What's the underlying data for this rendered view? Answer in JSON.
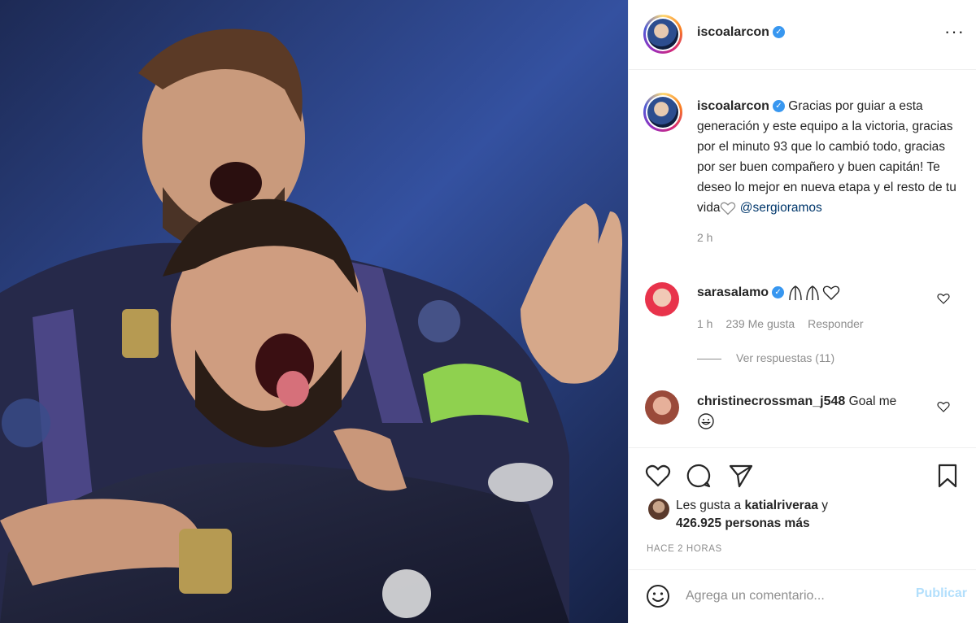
{
  "post": {
    "author": "iscoalarcon",
    "more_icon": "more-horizontal-icon",
    "image_description_icon": "photo"
  },
  "caption": {
    "username": "iscoalarcon",
    "text": "Gracias por guiar a esta generación y este equipo a la victoria, gracias por el minuto 93 que lo cambió todo, gracias por ser buen compañero y buen capitán! Te deseo lo mejor en nueva etapa y el resto de tu vida",
    "mention": "@sergioramos",
    "time": "2 h"
  },
  "comments": [
    {
      "username": "sarasalamo",
      "text": "",
      "time": "1 h",
      "likes": "239 Me gusta",
      "reply_label": "Responder",
      "view_replies": "Ver respuestas (11)"
    },
    {
      "username": "christinecrossman_j548",
      "text": "Goal me"
    }
  ],
  "likes": {
    "prefix": "Les gusta a",
    "user": "katialriveraa",
    "conj": "y",
    "count": "426.925 personas más"
  },
  "timestamp": "HACE 2 HORAS",
  "comment_box": {
    "placeholder": "Agrega un comentario...",
    "publish_label": "Publicar"
  },
  "colors": {
    "verified": "#3897f0",
    "mention": "#00376b",
    "publish_disabled": "#b2dffc"
  }
}
